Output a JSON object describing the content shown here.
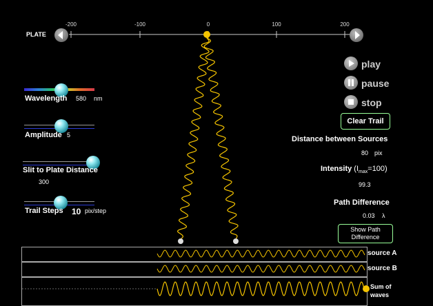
{
  "plate": {
    "label": "PLATE",
    "ticks": [
      "-200",
      "-100",
      "0",
      "100",
      "200"
    ]
  },
  "controls": {
    "play": "play",
    "pause": "pause",
    "stop": "stop",
    "clear_trail": "Clear Trail",
    "show_path": [
      "Show Path",
      "Difference"
    ]
  },
  "sliders": {
    "wavelength": {
      "label": "Wavelength",
      "value": "580",
      "unit": "nm"
    },
    "amplitude": {
      "label": "Amplitude",
      "value": "5"
    },
    "slit_distance": {
      "label": "Slit to Plate Distance",
      "value": "300"
    },
    "trail_steps": {
      "label": "Trail Steps",
      "value": "10",
      "unit": "pix/step"
    }
  },
  "readouts": {
    "distance_label": "Distance between Sources",
    "distance_value": "80",
    "distance_unit": "pix",
    "intensity_label": "Intensity",
    "intensity_i": "I",
    "intensity_sub": "max",
    "intensity_tail": "=100)",
    "intensity_value": "99.3",
    "path_label": "Path Difference",
    "path_value": "0.03",
    "path_unit": "λ"
  },
  "waves": {
    "source_a": "source A",
    "source_b": "source B",
    "sum": [
      "Sum of",
      "waves"
    ]
  },
  "icons": {
    "left_arrow": "left-arrow-icon",
    "right_arrow": "right-arrow-icon",
    "play": "play-icon",
    "pause": "pause-icon",
    "stop": "stop-icon"
  },
  "colors": {
    "wave": "#f5c400",
    "button_border": "#99ff99",
    "track_blue": "#2a3bd6"
  }
}
